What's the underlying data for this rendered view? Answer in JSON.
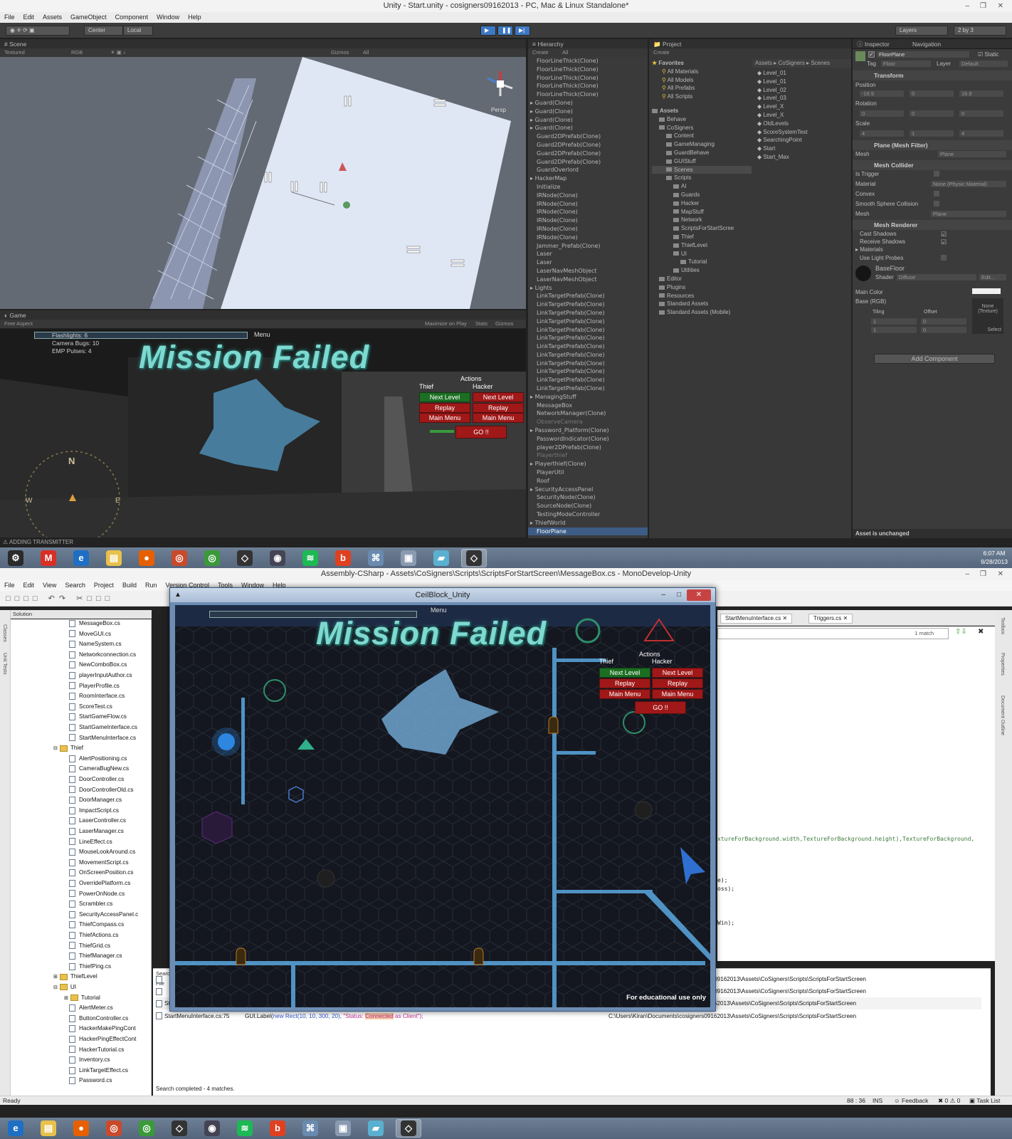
{
  "unity": {
    "title": "Unity - Start.unity - cosigners09162013 - PC, Mac & Linux Standalone*",
    "menu": [
      "File",
      "Edit",
      "Assets",
      "GameObject",
      "Component",
      "Window",
      "Help"
    ],
    "toolbar": {
      "center": "Center",
      "local": "Local",
      "layers": "Layers",
      "layout": "2 by 3"
    },
    "scene": {
      "tab": "Scene",
      "shading": "Textured",
      "color": "RGB",
      "gizmos": "Gizmos",
      "search": "All",
      "persp": "Persp"
    },
    "game": {
      "tab": "Game",
      "aspect": "Free Aspect",
      "options": [
        "Maximize on Play",
        "Stats",
        "Gizmos"
      ],
      "hud_lines": [
        "Flashlights: 6",
        "Camera Bugs: 10",
        "EMP Pulses: 4"
      ],
      "menu_label": "Menu",
      "mission_text": "Mission Failed",
      "actions_label": "Actions",
      "thief_label": "Thief",
      "hacker_label": "Hacker",
      "next_level": "Next Level",
      "replay": "Replay",
      "main_menu": "Main Menu",
      "go": "GO !!",
      "compass_n": "N",
      "compass_e": "E",
      "compass_w": "W"
    },
    "hierarchy": {
      "tab": "Hierarchy",
      "create": "Create",
      "search": "All",
      "items": [
        {
          "label": "FloorLineThick(Clone)",
          "style": ""
        },
        {
          "label": "FloorLineThick(Clone)",
          "style": ""
        },
        {
          "label": "FloorLineThick(Clone)",
          "style": ""
        },
        {
          "label": "FloorLineThick(Clone)",
          "style": ""
        },
        {
          "label": "FloorLineThick(Clone)",
          "style": ""
        },
        {
          "label": "Guard(Clone)",
          "style": "arrow"
        },
        {
          "label": "Guard(Clone)",
          "style": "arrow"
        },
        {
          "label": "Guard(Clone)",
          "style": "arrow"
        },
        {
          "label": "Guard(Clone)",
          "style": "arrow"
        },
        {
          "label": "Guard2DPrefab(Clone)",
          "style": ""
        },
        {
          "label": "Guard2DPrefab(Clone)",
          "style": ""
        },
        {
          "label": "Guard2DPrefab(Clone)",
          "style": ""
        },
        {
          "label": "Guard2DPrefab(Clone)",
          "style": ""
        },
        {
          "label": "GuardOverlord",
          "style": ""
        },
        {
          "label": "HackerMap",
          "style": "arrow"
        },
        {
          "label": "Initialize",
          "style": ""
        },
        {
          "label": "IRNode(Clone)",
          "style": ""
        },
        {
          "label": "IRNode(Clone)",
          "style": ""
        },
        {
          "label": "IRNode(Clone)",
          "style": ""
        },
        {
          "label": "IRNode(Clone)",
          "style": ""
        },
        {
          "label": "IRNode(Clone)",
          "style": ""
        },
        {
          "label": "IRNode(Clone)",
          "style": ""
        },
        {
          "label": "Jammer_Prefab(Clone)",
          "style": ""
        },
        {
          "label": "Laser",
          "style": ""
        },
        {
          "label": "Laser",
          "style": ""
        },
        {
          "label": "LaserNavMeshObject",
          "style": ""
        },
        {
          "label": "LaserNavMeshObject",
          "style": ""
        },
        {
          "label": "Lights",
          "style": "arrow"
        },
        {
          "label": "LinkTargetPrefab(Clone)",
          "style": ""
        },
        {
          "label": "LinkTargetPrefab(Clone)",
          "style": ""
        },
        {
          "label": "LinkTargetPrefab(Clone)",
          "style": ""
        },
        {
          "label": "LinkTargetPrefab(Clone)",
          "style": ""
        },
        {
          "label": "LinkTargetPrefab(Clone)",
          "style": ""
        },
        {
          "label": "LinkTargetPrefab(Clone)",
          "style": ""
        },
        {
          "label": "LinkTargetPrefab(Clone)",
          "style": ""
        },
        {
          "label": "LinkTargetPrefab(Clone)",
          "style": ""
        },
        {
          "label": "LinkTargetPrefab(Clone)",
          "style": ""
        },
        {
          "label": "LinkTargetPrefab(Clone)",
          "style": ""
        },
        {
          "label": "LinkTargetPrefab(Clone)",
          "style": ""
        },
        {
          "label": "LinkTargetPrefab(Clone)",
          "style": ""
        },
        {
          "label": "ManagingStuff",
          "style": "arrow"
        },
        {
          "label": "MessageBox",
          "style": ""
        },
        {
          "label": "NetworkManager(Clone)",
          "style": ""
        },
        {
          "label": "ObserveCamera",
          "style": "dim"
        },
        {
          "label": "Password_Platform(Clone)",
          "style": "arrow"
        },
        {
          "label": "PasswordIndicator(Clone)",
          "style": ""
        },
        {
          "label": "player2DPrefab(Clone)",
          "style": ""
        },
        {
          "label": "Playerthief",
          "style": "dim"
        },
        {
          "label": "Playerthief(Clone)",
          "style": "arrow"
        },
        {
          "label": "PlayerUtil",
          "style": ""
        },
        {
          "label": "Roof",
          "style": ""
        },
        {
          "label": "SecurityAccessPanel",
          "style": "arrow"
        },
        {
          "label": "SecurityNode(Clone)",
          "style": ""
        },
        {
          "label": "SourceNode(Clone)",
          "style": ""
        },
        {
          "label": "TestingModeController",
          "style": ""
        },
        {
          "label": "ThiefWorld",
          "style": "arrow"
        },
        {
          "label": "FloorPlane",
          "style": "sel"
        }
      ]
    },
    "project": {
      "tab": "Project",
      "create": "Create",
      "favorites_label": "Favorites",
      "favorites": [
        "All Materials",
        "All Models",
        "All Prefabs",
        "All Scripts"
      ],
      "tree": [
        {
          "label": "Assets",
          "indent": 0,
          "bold": true
        },
        {
          "label": "Behave",
          "indent": 1
        },
        {
          "label": "CoSigners",
          "indent": 1
        },
        {
          "label": "Content",
          "indent": 2
        },
        {
          "label": "GameManaging",
          "indent": 2
        },
        {
          "label": "GuardBehave",
          "indent": 2
        },
        {
          "label": "GUIStuff",
          "indent": 2
        },
        {
          "label": "Scenes",
          "indent": 2,
          "sel": true
        },
        {
          "label": "Scripts",
          "indent": 2
        },
        {
          "label": "AI",
          "indent": 3
        },
        {
          "label": "Guards",
          "indent": 3
        },
        {
          "label": "Hacker",
          "indent": 3
        },
        {
          "label": "MapStuff",
          "indent": 3
        },
        {
          "label": "Network",
          "indent": 3
        },
        {
          "label": "ScriptsForStartScree",
          "indent": 3
        },
        {
          "label": "Thief",
          "indent": 3
        },
        {
          "label": "ThiefLevel",
          "indent": 3
        },
        {
          "label": "UI",
          "indent": 3
        },
        {
          "label": "Tutorial",
          "indent": 4
        },
        {
          "label": "Utilities",
          "indent": 3
        },
        {
          "label": "Editor",
          "indent": 1
        },
        {
          "label": "Plugins",
          "indent": 1
        },
        {
          "label": "Resources",
          "indent": 1
        },
        {
          "label": "Standard Assets",
          "indent": 1
        },
        {
          "label": "Standard Assets (Mobile)",
          "indent": 1
        }
      ],
      "breadcrumb": [
        "Assets",
        "CoSigners",
        "Scenes"
      ],
      "files": [
        "Level_01",
        "Level_01",
        "Level_02",
        "Level_03",
        "Level_X",
        "Level_X",
        "OldLevels",
        "ScoreSystemTest",
        "SearchingPoint",
        "Start",
        "Start_Max"
      ]
    },
    "inspector": {
      "tab": "Inspector",
      "tab2": "Navigation",
      "object_name": "FloorPlane",
      "static_label": "Static",
      "tag_label": "Tag",
      "tag_value": "Floor",
      "layer_label": "Layer",
      "layer_value": "Default",
      "transform": "Transform",
      "position_label": "Position",
      "position": {
        "x": "-16.9",
        "y": "0",
        "z": "16.9"
      },
      "rotation_label": "Rotation",
      "rotation": {
        "x": "0",
        "y": "0",
        "z": "0"
      },
      "scale_label": "Scale",
      "scale": {
        "x": "4",
        "y": "1",
        "z": "4"
      },
      "mesh_filter": "Plane (Mesh Filter)",
      "mesh_label": "Mesh",
      "mesh_value": "Plane",
      "mesh_collider": "Mesh Collider",
      "is_trigger": "Is Trigger",
      "material_label": "Material",
      "material_value": "None (Physic Material)",
      "convex": "Convex",
      "smooth": "Smooth Sphere Collision",
      "collider_mesh_value": "Plane",
      "mesh_renderer": "Mesh Renderer",
      "cast_shadows": "Cast Shadows",
      "receive_shadows": "Receive Shadows",
      "materials": "Materials",
      "use_light_probes": "Use Light Probes",
      "material_name": "BaseFloor",
      "shader_label": "Shader",
      "shader_value": "Diffuse",
      "edit": "Edit...",
      "main_color": "Main Color",
      "base_rgb": "Base (RGB)",
      "tiling": "Tiling",
      "offset": "Offset",
      "tiling_x": "1",
      "tiling_y": "1",
      "offset_x": "0",
      "offset_y": "0",
      "texture_none": "None (Texture)",
      "select": "Select",
      "add_component": "Add Component",
      "asset_status": "Asset is unchanged"
    },
    "status": "ADDING TRANSMITTER"
  },
  "taskbar_top": {
    "icons": [
      "steam-icon",
      "gmail-icon",
      "ie-icon",
      "explorer-icon",
      "firefox-icon",
      "chrome-canary-icon",
      "chrome-icon",
      "unity-icon",
      "eye-icon",
      "spotify-icon",
      "b-icon",
      "network-icon",
      "monitor-icon",
      "paper-icon",
      "unity-active-icon"
    ],
    "time": "6:07 AM",
    "date": "9/28/2013"
  },
  "monodevelop": {
    "title": "Assembly-CSharp - Assets\\CoSigners\\Scripts\\ScriptsForStartScreen\\MessageBox.cs - MonoDevelop-Unity",
    "menu": [
      "File",
      "Edit",
      "View",
      "Search",
      "Project",
      "Build",
      "Run",
      "Version Control",
      "Tools",
      "Window",
      "Help"
    ],
    "solution_label": "Solution",
    "side_tabs": [
      "Classes",
      "Unit Tests"
    ],
    "right_tabs": [
      "Toolbox",
      "Properties",
      "Document Outline"
    ],
    "solution": [
      {
        "label": "MessageBox.cs",
        "t": "f",
        "i": 0
      },
      {
        "label": "MoveGUI.cs",
        "t": "f",
        "i": 0
      },
      {
        "label": "NameSystem.cs",
        "t": "f",
        "i": 0
      },
      {
        "label": "Networkconnection.cs",
        "t": "f",
        "i": 0
      },
      {
        "label": "NewComboBox.cs",
        "t": "f",
        "i": 0
      },
      {
        "label": "playerInputAuthor.cs",
        "t": "f",
        "i": 0
      },
      {
        "label": "PlayerProfile.cs",
        "t": "f",
        "i": 0
      },
      {
        "label": "RoomInterface.cs",
        "t": "f",
        "i": 0
      },
      {
        "label": "ScoreTest.cs",
        "t": "f",
        "i": 0
      },
      {
        "label": "StartGameFlow.cs",
        "t": "f",
        "i": 0
      },
      {
        "label": "StartGameInterface.cs",
        "t": "f",
        "i": 0
      },
      {
        "label": "StartMenuInterface.cs",
        "t": "f",
        "i": 0
      },
      {
        "label": "Thief",
        "t": "d",
        "i": -1
      },
      {
        "label": "AlertPositioning.cs",
        "t": "f",
        "i": 0
      },
      {
        "label": "CameraBugNew.cs",
        "t": "f",
        "i": 0
      },
      {
        "label": "DoorController.cs",
        "t": "f",
        "i": 0
      },
      {
        "label": "DoorControllerOld.cs",
        "t": "f",
        "i": 0
      },
      {
        "label": "DoorManager.cs",
        "t": "f",
        "i": 0
      },
      {
        "label": "ImpactScript.cs",
        "t": "f",
        "i": 0
      },
      {
        "label": "LaserController.cs",
        "t": "f",
        "i": 0
      },
      {
        "label": "LaserManager.cs",
        "t": "f",
        "i": 0
      },
      {
        "label": "LineEffect.cs",
        "t": "f",
        "i": 0
      },
      {
        "label": "MouseLookAround.cs",
        "t": "f",
        "i": 0
      },
      {
        "label": "MovementScript.cs",
        "t": "f",
        "i": 0
      },
      {
        "label": "OnScreenPosition.cs",
        "t": "f",
        "i": 0
      },
      {
        "label": "OverridePlatform.cs",
        "t": "f",
        "i": 0
      },
      {
        "label": "PowerOnNode.cs",
        "t": "f",
        "i": 0
      },
      {
        "label": "Scrambler.cs",
        "t": "f",
        "i": 0
      },
      {
        "label": "SecurityAccessPanel.c",
        "t": "f",
        "i": 0
      },
      {
        "label": "ThiefCompass.cs",
        "t": "f",
        "i": 0
      },
      {
        "label": "ThiefActions.cs",
        "t": "f",
        "i": 0
      },
      {
        "label": "ThiefGrid.cs",
        "t": "f",
        "i": 0
      },
      {
        "label": "ThiefManager.cs",
        "t": "f",
        "i": 0
      },
      {
        "label": "ThiefPing.cs",
        "t": "f",
        "i": 0
      },
      {
        "label": "ThiefLevel",
        "t": "d",
        "i": -1
      },
      {
        "label": "UI",
        "t": "d",
        "i": -1
      },
      {
        "label": "Tutorial",
        "t": "d",
        "i": 0
      },
      {
        "label": "AlertMeter.cs",
        "t": "f",
        "i": 0
      },
      {
        "label": "ButtonController.cs",
        "t": "f",
        "i": 0
      },
      {
        "label": "HackerMakePingCont",
        "t": "f",
        "i": 0
      },
      {
        "label": "HackerPingEffectCont",
        "t": "f",
        "i": 0
      },
      {
        "label": "HackerTutorial.cs",
        "t": "f",
        "i": 0
      },
      {
        "label": "Inventory.cs",
        "t": "f",
        "i": 0
      },
      {
        "label": "LinkTargetEffect.cs",
        "t": "f",
        "i": 0
      },
      {
        "label": "Password.cs",
        "t": "f",
        "i": 0
      }
    ],
    "doc_tabs": [
      "StartMenuInterface.cs",
      "Triggers.cs"
    ],
    "find_status": "1 match",
    "code_lines": [
      "xtureForBackground.width,TextureForBackground.height),TextureForBackground,",
      "e);",
      "oss);",
      "Win);"
    ],
    "results": [
      {
        "file": "",
        "code": "",
        "path": "s09162013\\Assets\\CoSigners\\Scripts\\ScriptsForStartScreen"
      },
      {
        "file": "",
        "code": "",
        "path": "s09162013\\Assets\\CoSigners\\Scripts\\ScriptsForStartScreen"
      },
      {
        "file": "StartMenuInterface.cs:71",
        "code_a": "GUI.Label(",
        "code_b": "new Rect(",
        "code_c": "10, 10, 300, 20), ",
        "code_d": "\"Status: ",
        "code_e": "Connected",
        "code_f": " as Server\");",
        "path": "C:\\Users\\Kiran\\Documents\\cosigners09162013\\Assets\\CoSigners\\Scripts\\ScriptsForStartScreen"
      },
      {
        "file": "StartMenuInterface.cs:75",
        "code_a": "GUI.Label(",
        "code_b": "new Rect(",
        "code_c": "10, 10, 300, 20), ",
        "code_d": "\"Status: ",
        "code_e": "Connected",
        "code_f": " as Client\");",
        "path": "C:\\Users\\Kiran\\Documents\\cosigners09162013\\Assets\\CoSigners\\Scripts\\ScriptsForStartScreen"
      }
    ],
    "search_label": "Searc",
    "file_label": "File",
    "search_done": "Search completed - 4 matches.",
    "status_ready": "Ready",
    "status_pos": "88 : 36",
    "status_ins": "INS",
    "feedback": "Feedback",
    "errors": "0",
    "warnings": "0",
    "tasklist": "Task List"
  },
  "ceilblock": {
    "title": "CeilBlock_Unity",
    "menu_label": "Menu",
    "mission_text": "Mission Failed",
    "actions_label": "Actions",
    "thief_label": "Thief",
    "hacker_label": "Hacker",
    "next_level": "Next Level",
    "replay": "Replay",
    "main_menu": "Main Menu",
    "go": "GO !!",
    "footer": "For educational use only"
  },
  "taskbar_bottom": {
    "icons": [
      "ie-icon",
      "explorer-icon",
      "firefox-icon",
      "chrome-canary-icon",
      "chrome-icon",
      "unity-icon",
      "eye-icon",
      "spotify-icon",
      "b-icon",
      "network-icon",
      "monitor-icon",
      "paper-icon",
      "unity-active-icon"
    ]
  },
  "colors": {
    "unity_dark": "#3a3a3a",
    "selection": "#3d5c85",
    "accent_red": "#a01818",
    "accent_green": "#1c6e22",
    "mission_cyan": "#7ed9d0"
  }
}
